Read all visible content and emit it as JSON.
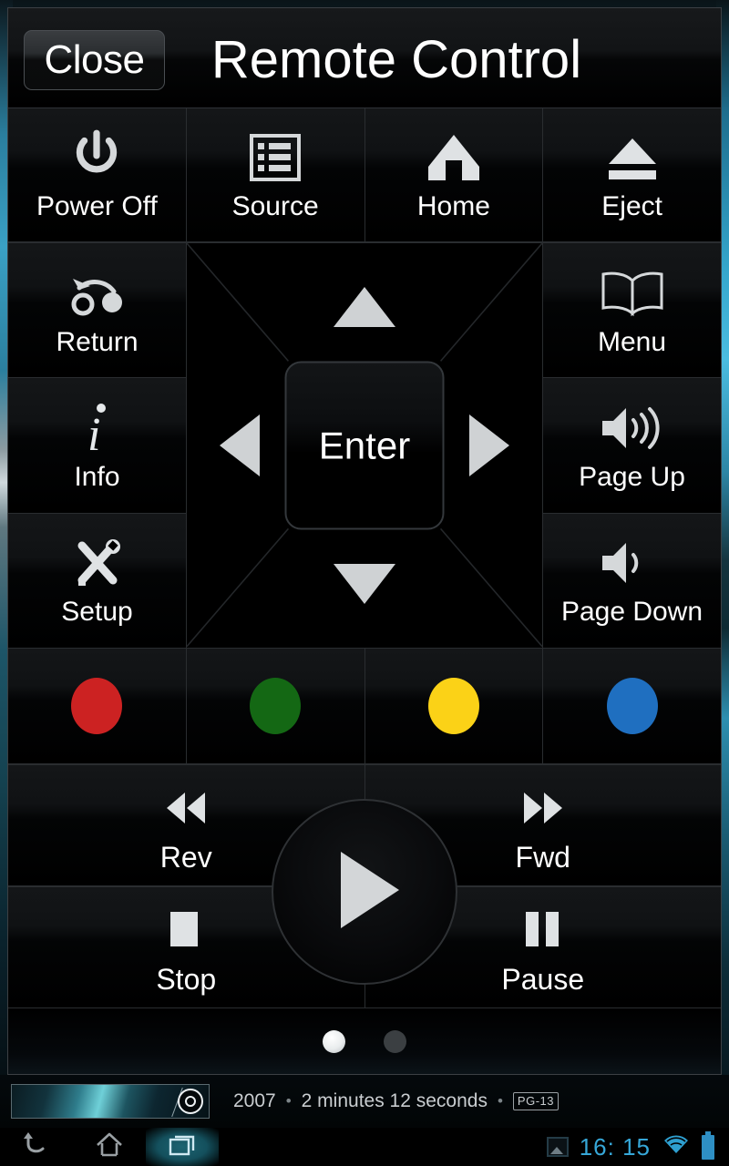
{
  "header": {
    "close_label": "Close",
    "title": "Remote Control"
  },
  "top_row": [
    {
      "label": "Power Off",
      "icon": "power-icon"
    },
    {
      "label": "Source",
      "icon": "list-icon"
    },
    {
      "label": "Home",
      "icon": "home-icon"
    },
    {
      "label": "Eject",
      "icon": "eject-icon"
    }
  ],
  "left_column": [
    {
      "label": "Return",
      "icon": "return-arrow-icon"
    },
    {
      "label": "Info",
      "icon": "info-i-icon"
    },
    {
      "label": "Setup",
      "icon": "tools-icon"
    }
  ],
  "right_column": [
    {
      "label": "Menu",
      "icon": "book-icon"
    },
    {
      "label": "Page Up",
      "icon": "volume-up-icon"
    },
    {
      "label": "Page Down",
      "icon": "volume-down-icon"
    }
  ],
  "dpad": {
    "up": "dpad-up-arrow",
    "down": "dpad-down-arrow",
    "left": "dpad-left-arrow",
    "right": "dpad-right-arrow",
    "enter_label": "Enter"
  },
  "color_buttons": [
    {
      "name": "red",
      "color": "#cc2222"
    },
    {
      "name": "green",
      "color": "#146814"
    },
    {
      "name": "yellow",
      "color": "#fbd217"
    },
    {
      "name": "blue",
      "color": "#1f6fc0"
    }
  ],
  "transport": {
    "rev_label": "Rev",
    "fwd_label": "Fwd",
    "stop_label": "Stop",
    "pause_label": "Pause",
    "play_icon": "play-triangle-icon"
  },
  "pager": {
    "total": 2,
    "active_index": 0
  },
  "media_info": {
    "year": "2007",
    "duration": "2 minutes 12 seconds",
    "rating": "PG-13",
    "separator": "•"
  },
  "navbar": {
    "back_icon": "back-arrow-icon",
    "home_icon": "home-outline-icon",
    "recent_icon": "recent-apps-icon",
    "screenshot_icon": "screenshot-icon",
    "clock": "16: 15",
    "wifi_icon": "wifi-icon",
    "battery_icon": "battery-icon"
  }
}
